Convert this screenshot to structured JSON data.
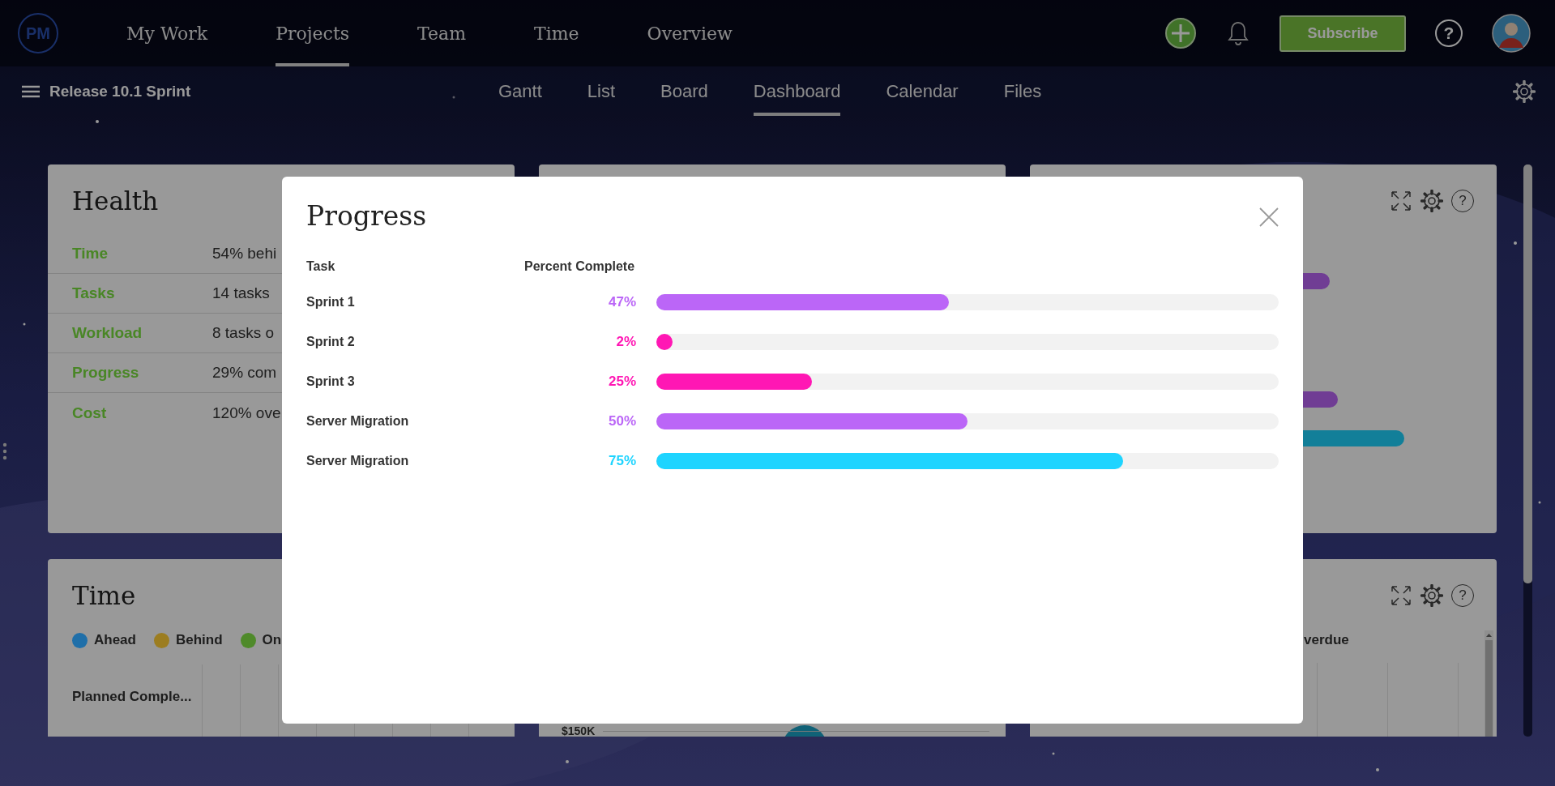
{
  "top_nav": {
    "logo": "PM",
    "items": [
      {
        "label": "My Work",
        "selected": false
      },
      {
        "label": "Projects",
        "selected": true
      },
      {
        "label": "Team",
        "selected": false
      },
      {
        "label": "Time",
        "selected": false
      },
      {
        "label": "Overview",
        "selected": false
      }
    ],
    "subscribe": "Subscribe",
    "help": "?"
  },
  "sub_nav": {
    "project": "Release 10.1 Sprint",
    "views": [
      {
        "label": "Gantt",
        "selected": false
      },
      {
        "label": "List",
        "selected": false
      },
      {
        "label": "Board",
        "selected": false
      },
      {
        "label": "Dashboard",
        "selected": true
      },
      {
        "label": "Calendar",
        "selected": false
      },
      {
        "label": "Files",
        "selected": false
      }
    ]
  },
  "cards": [
    {
      "kind": "health",
      "title": "Health",
      "rows": [
        {
          "label": "Time",
          "value": "54% behi"
        },
        {
          "label": "Tasks",
          "value": "14 tasks"
        },
        {
          "label": "Workload",
          "value": "8 tasks o"
        },
        {
          "label": "Progress",
          "value": "29% com"
        },
        {
          "label": "Cost",
          "value": "120% ove"
        }
      ]
    },
    {
      "kind": "blank"
    },
    {
      "kind": "bars",
      "help": "?"
    },
    {
      "kind": "time",
      "title": "Time",
      "legend": [
        {
          "label": "Ahead",
          "color": "#1f6fa9"
        },
        {
          "label": "Behind",
          "color": "#9c7d20"
        },
        {
          "label": "On",
          "color": "#4f8a2a"
        }
      ],
      "row_label": "Planned Comple..."
    },
    {
      "kind": "cost",
      "axis_label": "$150K"
    },
    {
      "kind": "overdue",
      "help": "?",
      "legend_label": "verdue"
    }
  ],
  "modal": {
    "title": "Progress",
    "columns": [
      "Task",
      "Percent Complete"
    ],
    "rows": [
      {
        "task": "Sprint 1",
        "percent": "47%",
        "level": 0.47,
        "color": "#bb66f7"
      },
      {
        "task": "Sprint 2",
        "percent": "2%",
        "level": 0.02,
        "color": "#ff17b4"
      },
      {
        "task": "Sprint 3",
        "percent": "25%",
        "level": 0.25,
        "color": "#ff17b4"
      },
      {
        "task": "Server Migration",
        "percent": "50%",
        "level": 0.5,
        "color": "#bb66f7"
      },
      {
        "task": "Server Migration",
        "percent": "75%",
        "level": 0.75,
        "color": "#1ed4ff"
      }
    ]
  }
}
